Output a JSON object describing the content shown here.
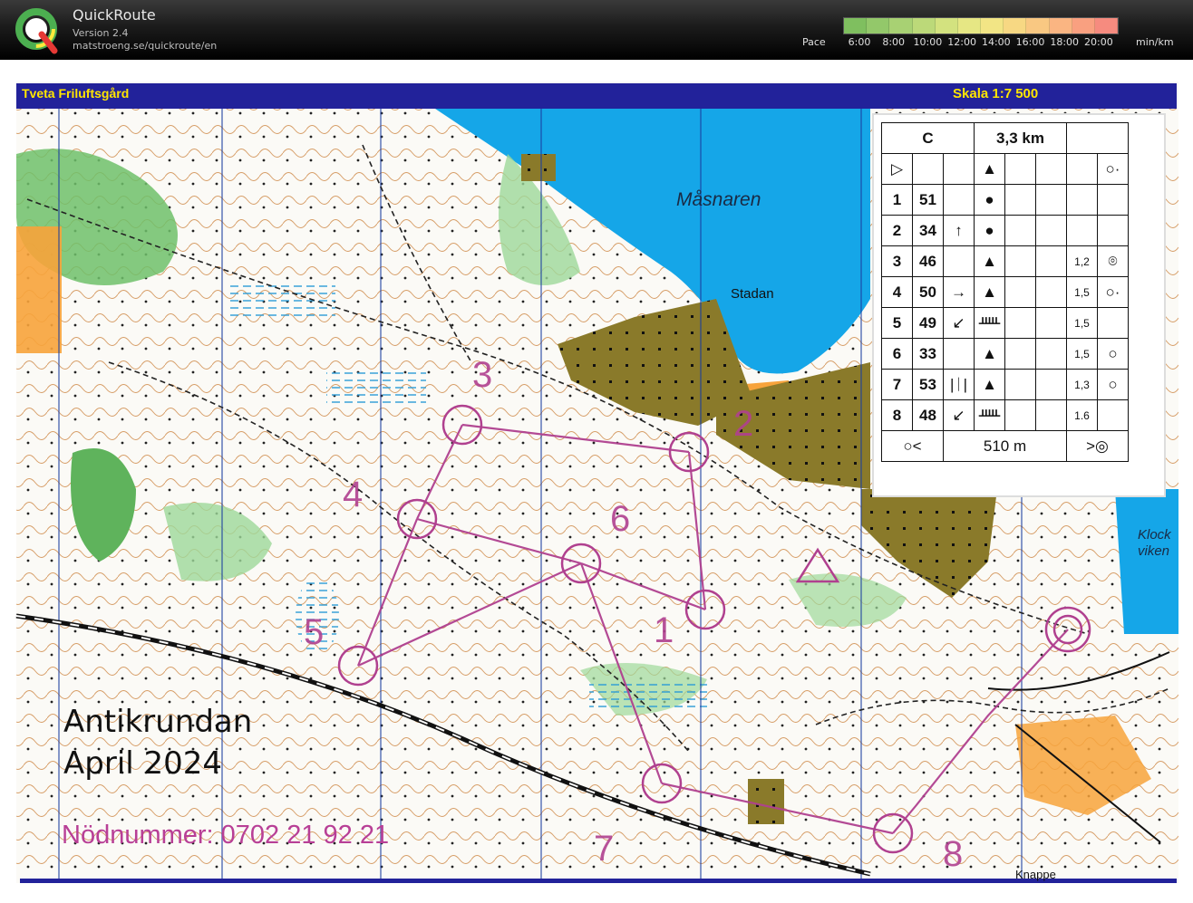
{
  "app": {
    "title": "QuickRoute",
    "version": "Version 2.4",
    "url": "matstroeng.se/quickroute/en",
    "logo_icon": "quickroute-q-logo"
  },
  "pace_legend": {
    "label": "Pace",
    "ticks": [
      "6:00",
      "8:00",
      "10:00",
      "12:00",
      "14:00",
      "16:00",
      "18:00",
      "20:00"
    ],
    "unit": "min/km",
    "colors": [
      "#7fbf5f",
      "#93c86a",
      "#a8d173",
      "#bcd979",
      "#d3e27f",
      "#e6e784",
      "#f2e585",
      "#f7d883",
      "#f9c882",
      "#fab582",
      "#f9a080",
      "#f68b7f"
    ]
  },
  "map": {
    "club": "Tveta Friluftsgård",
    "scale": "Skala 1:7 500",
    "event_title": "Antikrundan",
    "event_date": "April 2024",
    "emergency": "Nödnummer: 0702 21 92 21",
    "places": {
      "lake": "Måsnaren",
      "stadan": "Stadan",
      "klock": "Klock viken",
      "knappe": "Knappe"
    },
    "control_numbers": [
      "1",
      "2",
      "3",
      "4",
      "5",
      "6",
      "7",
      "8"
    ],
    "course_color": "#b0408f"
  },
  "control_description": {
    "course": "C",
    "length": "3,3 km",
    "start_symbol": "start-triangle",
    "rows": [
      {
        "num": "1",
        "code": "51",
        "c": "",
        "d": "●",
        "size": "",
        "h": ""
      },
      {
        "num": "2",
        "code": "34",
        "c": "↑",
        "d": "●",
        "size": "",
        "h": ""
      },
      {
        "num": "3",
        "code": "46",
        "c": "",
        "d": "▲",
        "size": "1,2",
        "h": "⌾"
      },
      {
        "num": "4",
        "code": "50",
        "c": "→",
        "d": "▲",
        "size": "1,5",
        "h": "○·"
      },
      {
        "num": "5",
        "code": "49",
        "c": "↙",
        "d": "ᚊ",
        "size": "1,5",
        "h": ""
      },
      {
        "num": "6",
        "code": "33",
        "c": "",
        "d": "▲",
        "size": "1,5",
        "h": "○"
      },
      {
        "num": "7",
        "code": "53",
        "c": "|ᛁ|",
        "d": "▲",
        "size": "1,3",
        "h": "○"
      },
      {
        "num": "8",
        "code": "48",
        "c": "↙",
        "d": "ᚊ",
        "size": "1.6",
        "h": ""
      }
    ],
    "finish_distance": "510 m"
  }
}
